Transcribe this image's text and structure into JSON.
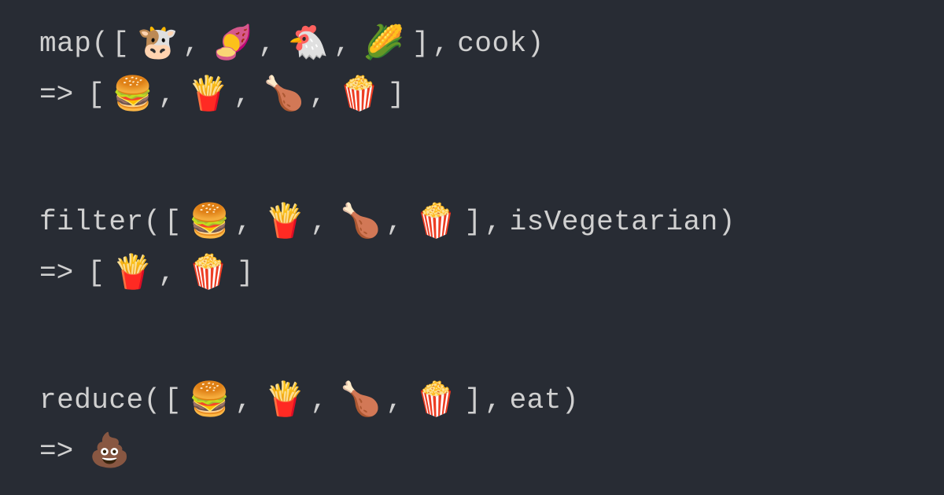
{
  "map": {
    "fname": "map",
    "open": "(",
    "lbr": "[",
    "rbr": "]",
    "close": ")",
    "sep": ",",
    "callback": "cook",
    "inputs": [
      "🐮",
      "🍠",
      "🐔",
      "🌽"
    ],
    "arrow": "=>",
    "outputs": [
      "🍔",
      "🍟",
      "🍗",
      "🍿"
    ]
  },
  "filter": {
    "fname": "filter",
    "open": "(",
    "lbr": "[",
    "rbr": "]",
    "close": ")",
    "sep": ",",
    "callback": "isVegetarian",
    "inputs": [
      "🍔",
      "🍟",
      "🍗",
      "🍿"
    ],
    "arrow": "=>",
    "outputs": [
      "🍟",
      "🍿"
    ]
  },
  "reduce": {
    "fname": "reduce",
    "open": "(",
    "lbr": "[",
    "rbr": "]",
    "close": ")",
    "sep": ",",
    "callback": "eat",
    "inputs": [
      "🍔",
      "🍟",
      "🍗",
      "🍿"
    ],
    "arrow": "=>",
    "output": "💩"
  }
}
